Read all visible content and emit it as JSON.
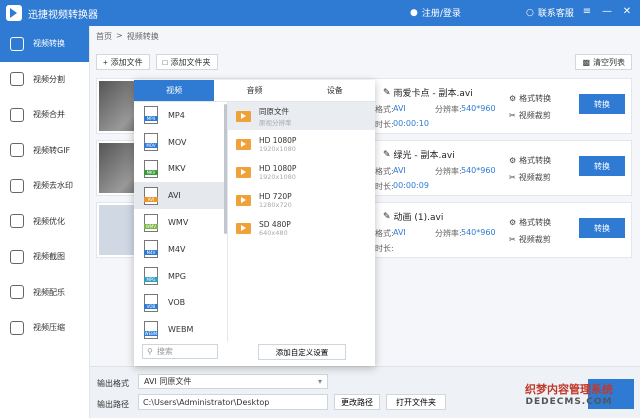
{
  "app": {
    "title": "迅捷视频转换器",
    "login": "注册/登录",
    "support": "联系客服",
    "win_buttons": [
      "≡",
      "—",
      "✕"
    ]
  },
  "sidebar": {
    "items": [
      {
        "label": "视频转换",
        "icon": "convert-icon"
      },
      {
        "label": "视频分割",
        "icon": "split-icon"
      },
      {
        "label": "视频合并",
        "icon": "merge-icon"
      },
      {
        "label": "视频转GIF",
        "icon": "gif-icon"
      },
      {
        "label": "视频去水印",
        "icon": "watermark-icon"
      },
      {
        "label": "视频优化",
        "icon": "optimize-icon"
      },
      {
        "label": "视频截图",
        "icon": "screenshot-icon"
      },
      {
        "label": "视频配乐",
        "icon": "music-icon"
      },
      {
        "label": "视频压缩",
        "icon": "compress-icon"
      }
    ]
  },
  "breadcrumb": {
    "home": "首页",
    "sep": ">",
    "current": "视频转换"
  },
  "toolbar": {
    "add_file": "添加文件",
    "add_folder": "添加文件夹",
    "clear": "清空列表"
  },
  "files": [
    {
      "name": "雨爱卡点 - 副本.avi",
      "format_label": "格式:",
      "format": "AVI",
      "resolution_label": "分辨率:",
      "resolution": "540*960",
      "duration_label": "时长:",
      "duration": "00:00:10"
    },
    {
      "name": "绿光 - 副本.avi",
      "format_label": "格式:",
      "format": "AVI",
      "resolution_label": "分辨率:",
      "resolution": "540*960",
      "duration_label": "时长:",
      "duration": "00:00:09"
    },
    {
      "name": "动画 (1).avi",
      "format_label": "格式:",
      "format": "AVI",
      "resolution_label": "分辨率:",
      "resolution": "540*960",
      "duration_label": "时长:",
      "duration": ""
    }
  ],
  "file_actions": {
    "format_convert": "格式转换",
    "video_crop": "视频裁剪",
    "convert": "转换"
  },
  "popup": {
    "tabs": [
      "视频",
      "音频",
      "设备"
    ],
    "formats": [
      {
        "label": "MP4",
        "color": "#2f7bd3"
      },
      {
        "label": "MOV",
        "color": "#2f7bd3"
      },
      {
        "label": "MKV",
        "color": "#3a9a3a"
      },
      {
        "label": "AVI",
        "color": "#e8962e"
      },
      {
        "label": "WMV",
        "color": "#7ab648"
      },
      {
        "label": "M4V",
        "color": "#2f7bd3"
      },
      {
        "label": "MPG",
        "color": "#2fa0c0"
      },
      {
        "label": "VOB",
        "color": "#2f7bd3"
      },
      {
        "label": "WEBM",
        "color": "#2f7bd3"
      }
    ],
    "active_format": "AVI",
    "resolutions": [
      {
        "title": "同原文件",
        "sub": "原视分辨率"
      },
      {
        "title": "HD 1080P",
        "sub": "1920x1080"
      },
      {
        "title": "HD 1080P",
        "sub": "1920x1080"
      },
      {
        "title": "HD 720P",
        "sub": "1280x720"
      },
      {
        "title": "SD 480P",
        "sub": "640x480"
      }
    ],
    "search_placeholder": "搜索",
    "custom_button": "添加自定义设置"
  },
  "bottom": {
    "output_format_label": "输出格式",
    "output_format_value": "AVI 同原文件",
    "output_path_label": "输出路径",
    "output_path_value": "C:\\Users\\Administrator\\Desktop",
    "change_path": "更改路径",
    "open_folder": "打开文件夹"
  },
  "watermark": {
    "line1": "织梦内容管理系统",
    "line2": "DEDECMS.COM"
  }
}
